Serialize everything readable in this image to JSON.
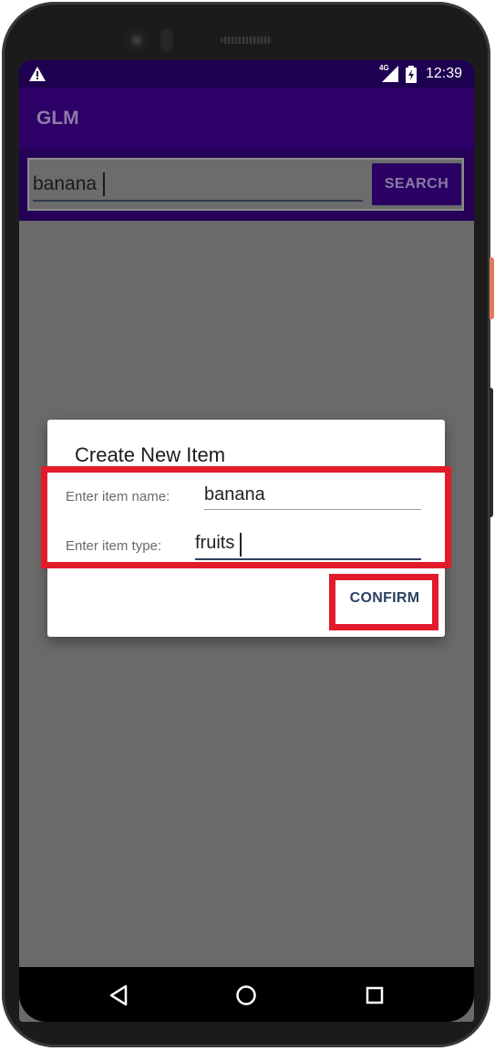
{
  "status_bar": {
    "network_type": "4G",
    "time": "12:39"
  },
  "app_bar": {
    "title": "GLM"
  },
  "search": {
    "query": "banana",
    "button_label": "SEARCH"
  },
  "dialog": {
    "title": "Create New Item",
    "name_label": "Enter item name:",
    "name_value": "banana",
    "type_label": "Enter item type:",
    "type_value": "fruits",
    "confirm_label": "CONFIRM"
  },
  "highlight_color": "#e11b2a",
  "icons": {
    "status": [
      "warning-icon",
      "signal-icon",
      "battery-charging-icon"
    ],
    "navigation": [
      "back-icon",
      "home-icon",
      "recents-icon"
    ]
  }
}
